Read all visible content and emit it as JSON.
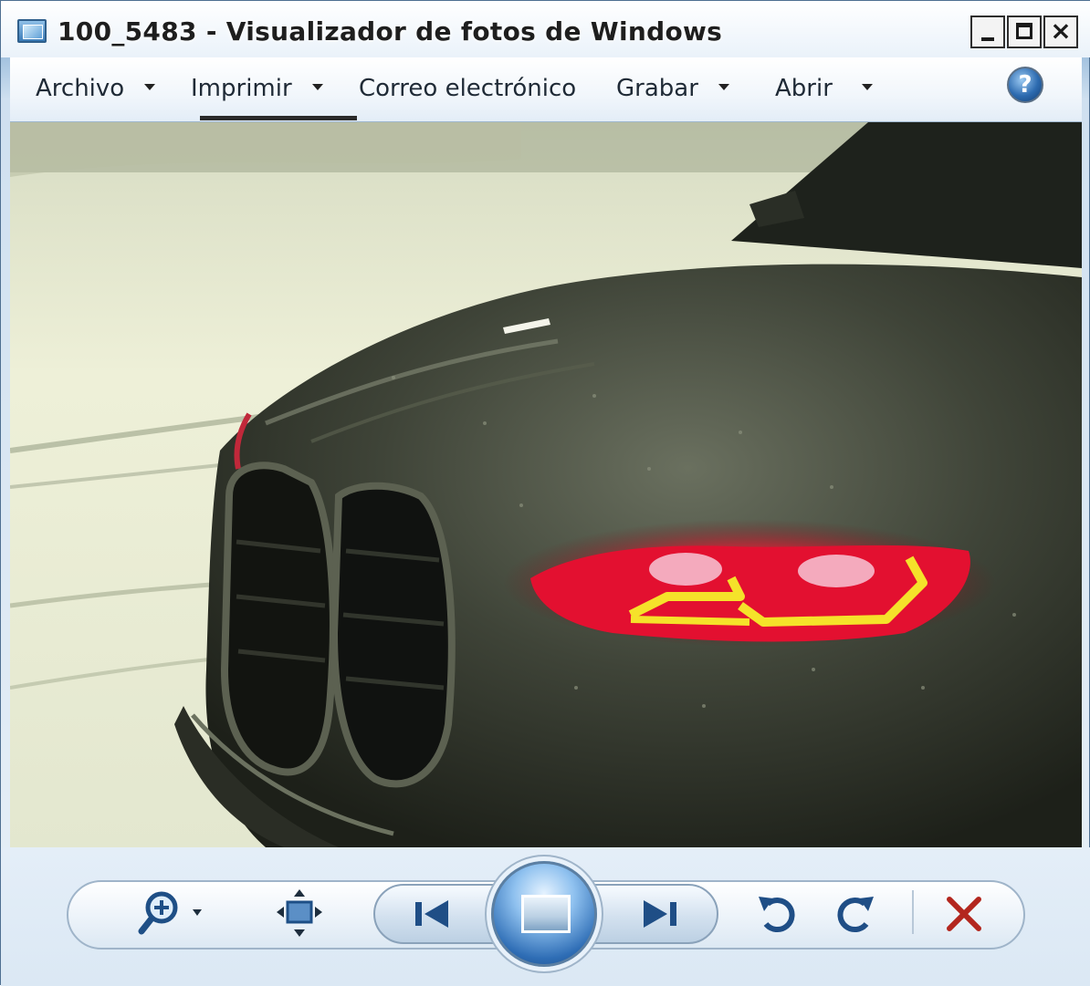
{
  "window": {
    "title": "100_5483 - Visualizador de fotos de Windows"
  },
  "menu": {
    "items": [
      {
        "label": "Archivo",
        "has_dropdown": true
      },
      {
        "label": "Imprimir",
        "has_dropdown": true
      },
      {
        "label": "Correo electrónico",
        "has_dropdown": false
      },
      {
        "label": "Grabar",
        "has_dropdown": true
      },
      {
        "label": "Abrir",
        "has_dropdown": true
      }
    ],
    "help_icon": "help-icon"
  },
  "controls": {
    "icons": [
      "zoom-icon",
      "fit-to-window-icon",
      "previous-icon",
      "slideshow-icon",
      "next-icon",
      "rotate-left-icon",
      "rotate-right-icon",
      "delete-icon"
    ]
  },
  "colors": {
    "delete_accent": "#b3261e",
    "control_blue": "#2b5f9a",
    "taillight_red": "#ff1a2e",
    "taillight_yellow": "#f5e22a"
  }
}
